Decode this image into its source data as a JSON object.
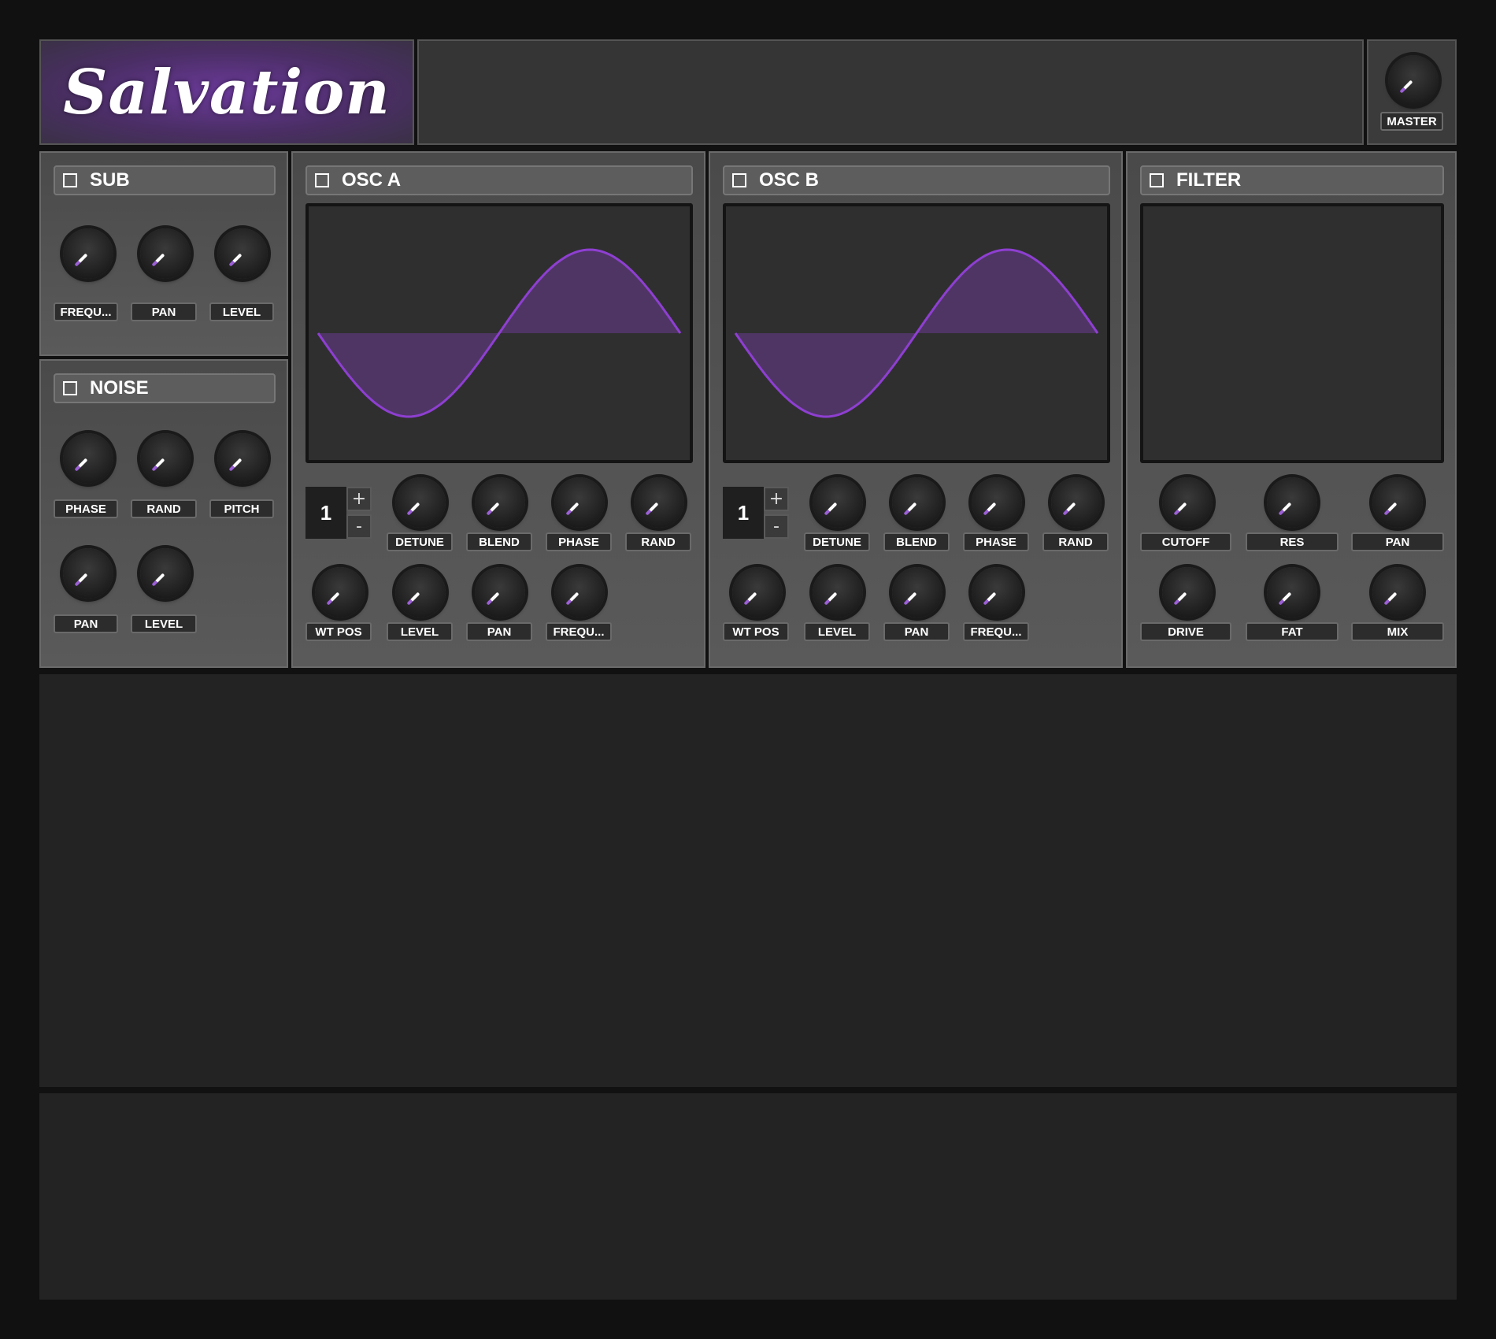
{
  "logo": "Salvation",
  "master": {
    "label": "MASTER",
    "value": 0.0
  },
  "sub": {
    "title": "SUB",
    "enabled": false,
    "knobs": [
      {
        "label": "FREQU...",
        "value": 0.0
      },
      {
        "label": "PAN",
        "value": 0.0
      },
      {
        "label": "LEVEL",
        "value": 0.0
      }
    ]
  },
  "noise": {
    "title": "NOISE",
    "enabled": false,
    "knobs": [
      {
        "label": "PHASE",
        "value": 0.0
      },
      {
        "label": "RAND",
        "value": 0.0
      },
      {
        "label": "PITCH",
        "value": 0.0
      },
      {
        "label": "PAN",
        "value": 0.0
      },
      {
        "label": "LEVEL",
        "value": 0.0
      }
    ]
  },
  "osc_a": {
    "title": "OSC A",
    "enabled": false,
    "voices": "1",
    "plus": "+",
    "minus": "-",
    "knobs": [
      {
        "label": "DETUNE",
        "value": 0.0
      },
      {
        "label": "BLEND",
        "value": 0.0
      },
      {
        "label": "PHASE",
        "value": 0.0
      },
      {
        "label": "RAND",
        "value": 0.0
      },
      {
        "label": "WT POS",
        "value": 0.0
      },
      {
        "label": "LEVEL",
        "value": 0.0
      },
      {
        "label": "PAN",
        "value": 0.0
      },
      {
        "label": "FREQU...",
        "value": 0.0
      }
    ]
  },
  "osc_b": {
    "title": "OSC B",
    "enabled": false,
    "voices": "1",
    "plus": "+",
    "minus": "-",
    "knobs": [
      {
        "label": "DETUNE",
        "value": 0.0
      },
      {
        "label": "BLEND",
        "value": 0.0
      },
      {
        "label": "PHASE",
        "value": 0.0
      },
      {
        "label": "RAND",
        "value": 0.0
      },
      {
        "label": "WT POS",
        "value": 0.0
      },
      {
        "label": "LEVEL",
        "value": 0.0
      },
      {
        "label": "PAN",
        "value": 0.0
      },
      {
        "label": "FREQU...",
        "value": 0.0
      }
    ]
  },
  "filter": {
    "title": "FILTER",
    "enabled": false,
    "knobs": [
      {
        "label": "CUTOFF",
        "value": 0.0
      },
      {
        "label": "RES",
        "value": 0.0
      },
      {
        "label": "PAN",
        "value": 0.0
      },
      {
        "label": "DRIVE",
        "value": 0.0
      },
      {
        "label": "FAT",
        "value": 0.0
      },
      {
        "label": "MIX",
        "value": 0.0
      }
    ]
  },
  "colors": {
    "accent": "#8e3fd1",
    "accent_fill": "#6a3a8f"
  }
}
